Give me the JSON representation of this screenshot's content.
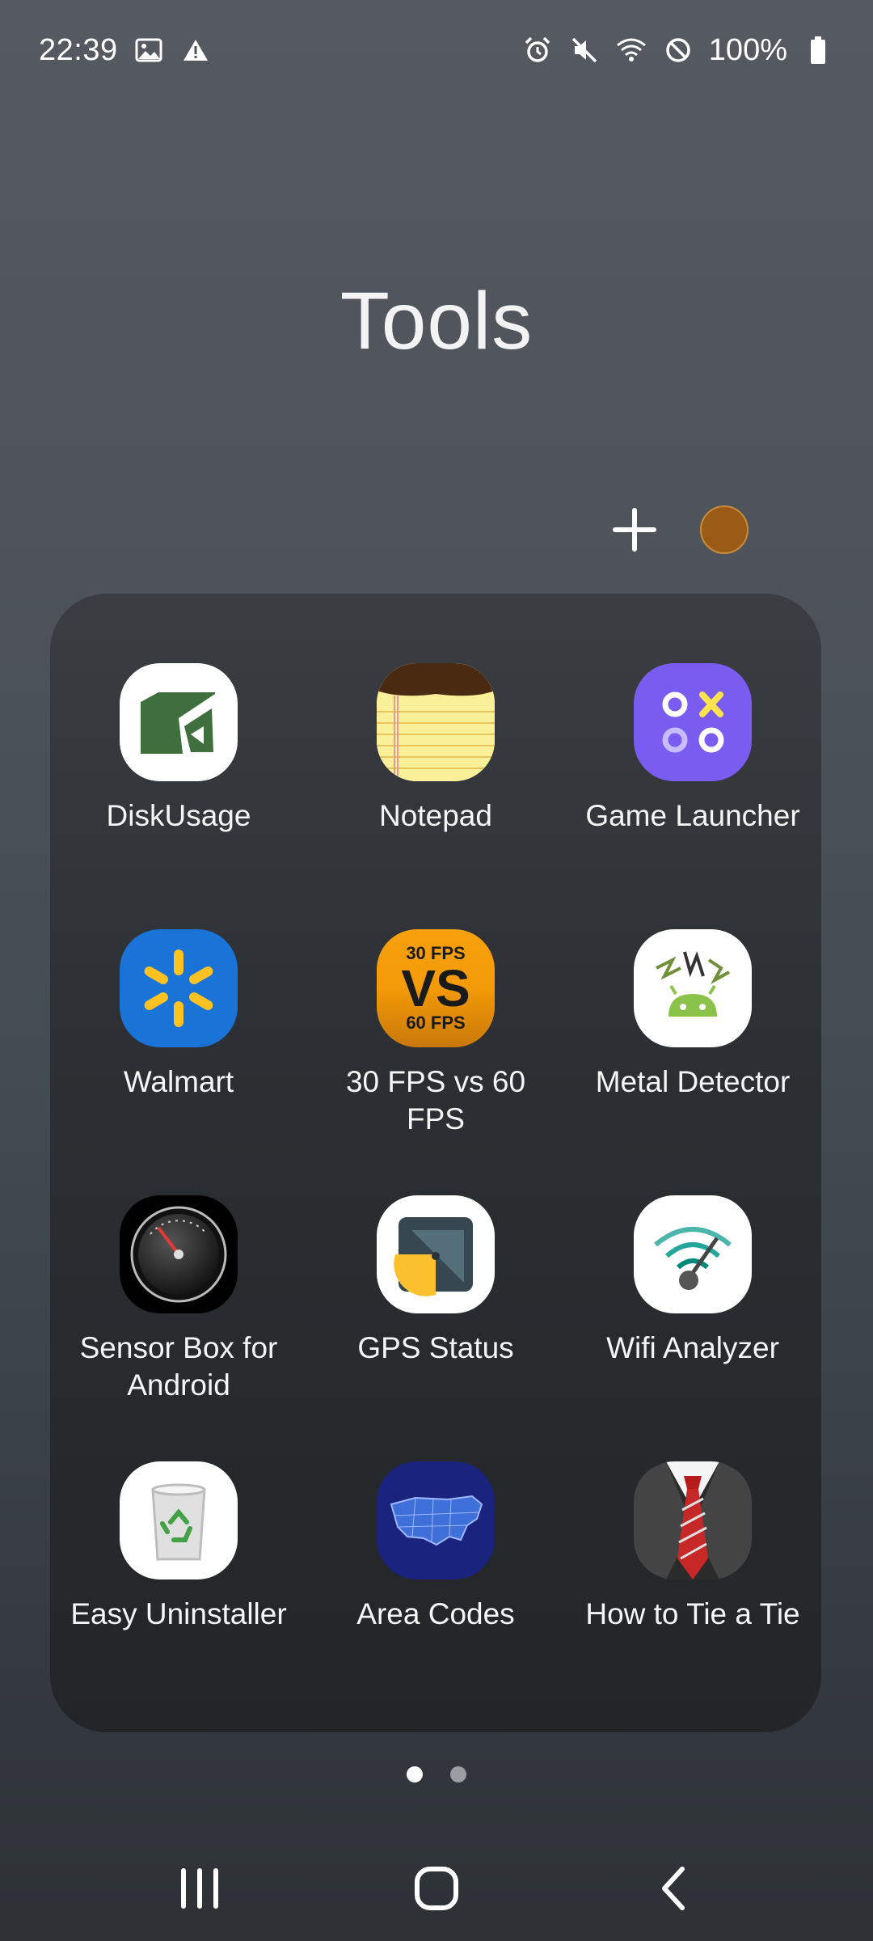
{
  "status_bar": {
    "time": "22:39",
    "battery_percent": "100%",
    "icons_left": [
      "image-icon",
      "warning-icon"
    ],
    "icons_right": [
      "alarm-icon",
      "mute-icon",
      "wifi-icon",
      "do-not-disturb-icon",
      "battery-icon"
    ]
  },
  "folder": {
    "title": "Tools",
    "accent_color": "#9a5b16"
  },
  "apps": [
    {
      "label": "DiskUsage",
      "icon": "diskusage-icon"
    },
    {
      "label": "Notepad",
      "icon": "notepad-icon"
    },
    {
      "label": "Game Launcher",
      "icon": "game-launcher-icon"
    },
    {
      "label": "Walmart",
      "icon": "walmart-icon"
    },
    {
      "label": "30 FPS vs 60 FPS",
      "icon": "fps-icon",
      "icon_text": {
        "top": "30 FPS",
        "middle": "VS",
        "bottom": "60 FPS"
      }
    },
    {
      "label": "Metal Detector",
      "icon": "metal-detector-icon"
    },
    {
      "label": "Sensor Box for Android",
      "icon": "sensor-box-icon"
    },
    {
      "label": "GPS Status",
      "icon": "gps-status-icon"
    },
    {
      "label": "Wifi Analyzer",
      "icon": "wifi-analyzer-icon"
    },
    {
      "label": "Easy Uninstaller",
      "icon": "easy-uninstaller-icon"
    },
    {
      "label": "Area Codes",
      "icon": "area-codes-icon"
    },
    {
      "label": "How to Tie a Tie",
      "icon": "tie-icon"
    }
  ],
  "pager": {
    "current": 1,
    "total": 2
  },
  "nav_bar": [
    "recents-button",
    "home-button",
    "back-button"
  ]
}
